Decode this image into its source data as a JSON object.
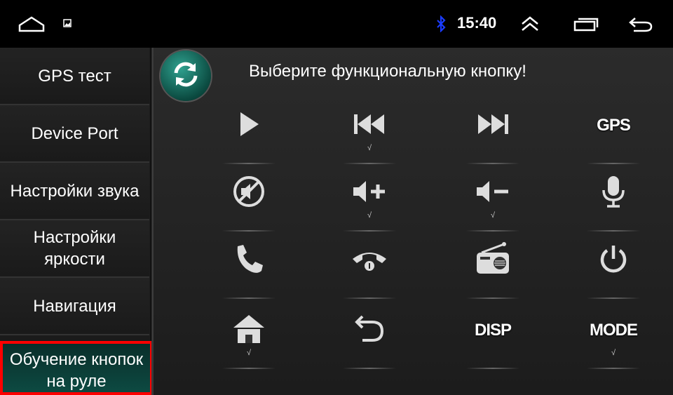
{
  "statusbar": {
    "clock": "15:40",
    "icons": [
      "home-icon",
      "image-icon",
      "bluetooth-icon",
      "expand-up-icon",
      "recent-apps-icon",
      "back-icon"
    ]
  },
  "sidebar": {
    "items": [
      {
        "label": "GPS тест"
      },
      {
        "label": "Device Port"
      },
      {
        "label": "Настройки звука"
      },
      {
        "label": "Настройки\nяркости"
      },
      {
        "label": "Навигация"
      },
      {
        "label": "Обучение кнопок\nна руле"
      }
    ],
    "active_index": 5
  },
  "main": {
    "title": "Выберите функциональную кнопку!",
    "buttons": [
      {
        "name": "play",
        "check": ""
      },
      {
        "name": "prev",
        "check": "√"
      },
      {
        "name": "next",
        "check": ""
      },
      {
        "name": "gps",
        "label": "GPS",
        "check": ""
      },
      {
        "name": "mute",
        "check": ""
      },
      {
        "name": "vol-up",
        "check": "√"
      },
      {
        "name": "vol-down",
        "check": "√"
      },
      {
        "name": "mic",
        "check": ""
      },
      {
        "name": "call",
        "check": ""
      },
      {
        "name": "hangup",
        "check": ""
      },
      {
        "name": "radio",
        "check": ""
      },
      {
        "name": "power",
        "check": ""
      },
      {
        "name": "home",
        "check": "√"
      },
      {
        "name": "back",
        "check": ""
      },
      {
        "name": "disp",
        "label": "DISP",
        "check": ""
      },
      {
        "name": "mode",
        "label": "MODE",
        "check": "√"
      }
    ]
  },
  "colors": {
    "accent": "#0d4a42",
    "highlight": "#ff0000",
    "bluetooth": "#1a3cff"
  }
}
